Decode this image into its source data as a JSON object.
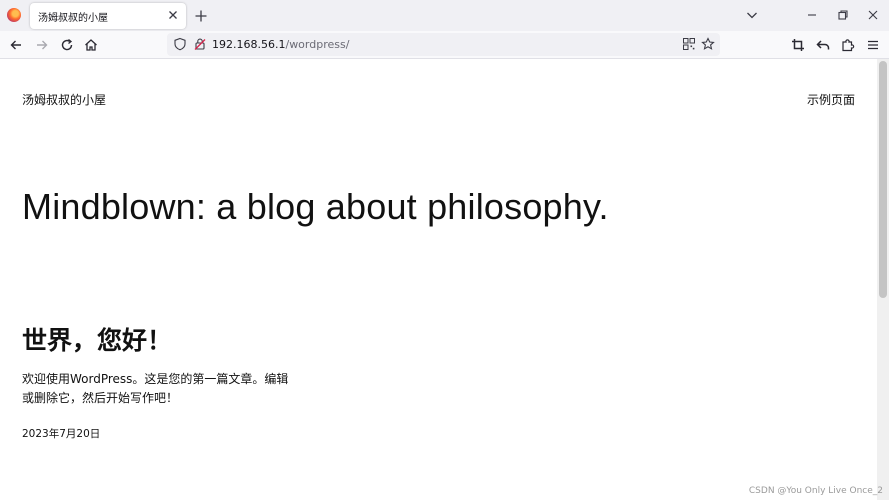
{
  "browser": {
    "tab": {
      "title": "汤姆叔叔的小屋"
    },
    "icons": {
      "favicon": "firefox-logo-icon",
      "close_tab": "close-icon",
      "new_tab": "plus-icon",
      "list_tabs": "chevron-down-icon",
      "minimize": "minimize-icon",
      "restore": "restore-icon",
      "close_window": "close-icon"
    },
    "url": {
      "host": "192.168.56.1",
      "path": "/wordpress/"
    },
    "colors": {
      "tabbar_bg": "#f0f0f4",
      "toolbar_bg": "#f9f9fb",
      "insecure_red": "#d7264c"
    }
  },
  "site": {
    "title": "汤姆叔叔的小屋",
    "nav": {
      "sample_page": "示例页面"
    },
    "hero": "Mindblown: a blog about philosophy."
  },
  "post": {
    "title": "世界，您好！",
    "excerpt_line1": "欢迎使用WordPress。这是您的第一篇文章。编辑",
    "excerpt_line2": "或删除它，然后开始写作吧！",
    "date": "2023年7月20日"
  },
  "watermark": "CSDN @You Only Live Once_2"
}
